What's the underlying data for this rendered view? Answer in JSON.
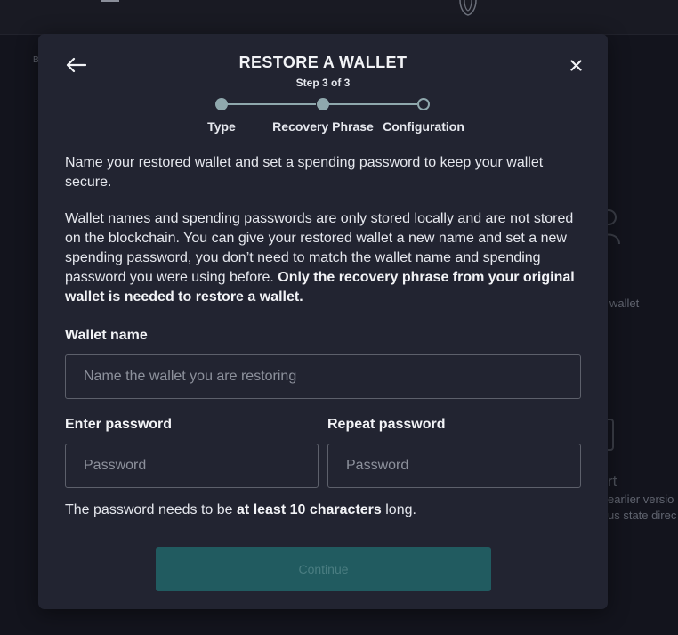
{
  "background": {
    "fragment_b": "B",
    "fragment_wallet": "wallet",
    "fragment_rt": "rt",
    "fragment_earlier": "earlier versio",
    "fragment_state": "us state direc"
  },
  "modal": {
    "title": "RESTORE A WALLET",
    "subtitle": "Step 3 of 3",
    "back_icon": "arrow-left-icon",
    "close_icon": "close-icon",
    "steps": [
      {
        "label": "Type",
        "status": "done"
      },
      {
        "label": "Recovery Phrase",
        "status": "done"
      },
      {
        "label": "Configuration",
        "status": "current"
      }
    ],
    "intro": "Name your restored wallet and set a spending password to keep your wallet secure.",
    "details": "Wallet names and spending passwords are only stored locally and are not stored on the blockchain. You can give your restored wallet a new name and set a new spending password, you don’t need to match the wallet name and spending password you were using before.",
    "details_bold": "Only the recovery phrase from your original wallet is needed to restore a wallet.",
    "wallet_name": {
      "label": "Wallet name",
      "placeholder": "Name the wallet you are restoring",
      "value": ""
    },
    "password": {
      "label": "Enter password",
      "placeholder": "Password",
      "value": ""
    },
    "repeat_password": {
      "label": "Repeat password",
      "placeholder": "Password",
      "value": ""
    },
    "hint_prefix": "The password needs to be",
    "hint_bold": "at least 10 characters",
    "hint_suffix": "long.",
    "continue_label": "Continue"
  },
  "colors": {
    "accent": "#215b60",
    "step": "#8fa8ad",
    "modal_bg": "#222431",
    "page_bg": "#13141d"
  }
}
